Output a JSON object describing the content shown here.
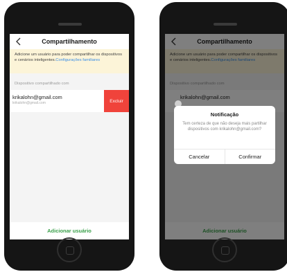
{
  "screen1": {
    "title": "Compartilhamento",
    "notice_text": "Adicione um usuário para poder compartilhar os dispositivos e cenários inteligentes.",
    "notice_link": "Configurações familiares",
    "section_label": "Dispositivo compartilhado com",
    "shared_user": {
      "email": "krikalohn@gmail.com",
      "subtext": "krikalohn@gmail.com",
      "delete_label": "Excluir"
    },
    "add_user_label": "Adicionar usuário"
  },
  "screen2": {
    "title": "Compartilhamento",
    "notice_text": "Adicione um usuário para poder compartilhar os dispositivos e cenários inteligentes.",
    "notice_link": "Configurações familiares",
    "section_label": "Dispositivo compartilhado com",
    "shared_user_email": "krikalohn@gmail.com",
    "add_user_label": "Adicionar usuário",
    "dialog": {
      "title": "Notificação",
      "message": "Tem certeza de que não deseja mais partilhar dispositivos com krikalohn@gmail.com?",
      "cancel_label": "Cancelar",
      "confirm_label": "Confirmar"
    }
  },
  "colors": {
    "delete": "#f0433b",
    "link": "#3a8ee6",
    "add_user": "#3aa04a",
    "notice_bg": "#fcf4d8"
  },
  "icons": [
    "back-chevron-icon",
    "home-button-icon"
  ]
}
